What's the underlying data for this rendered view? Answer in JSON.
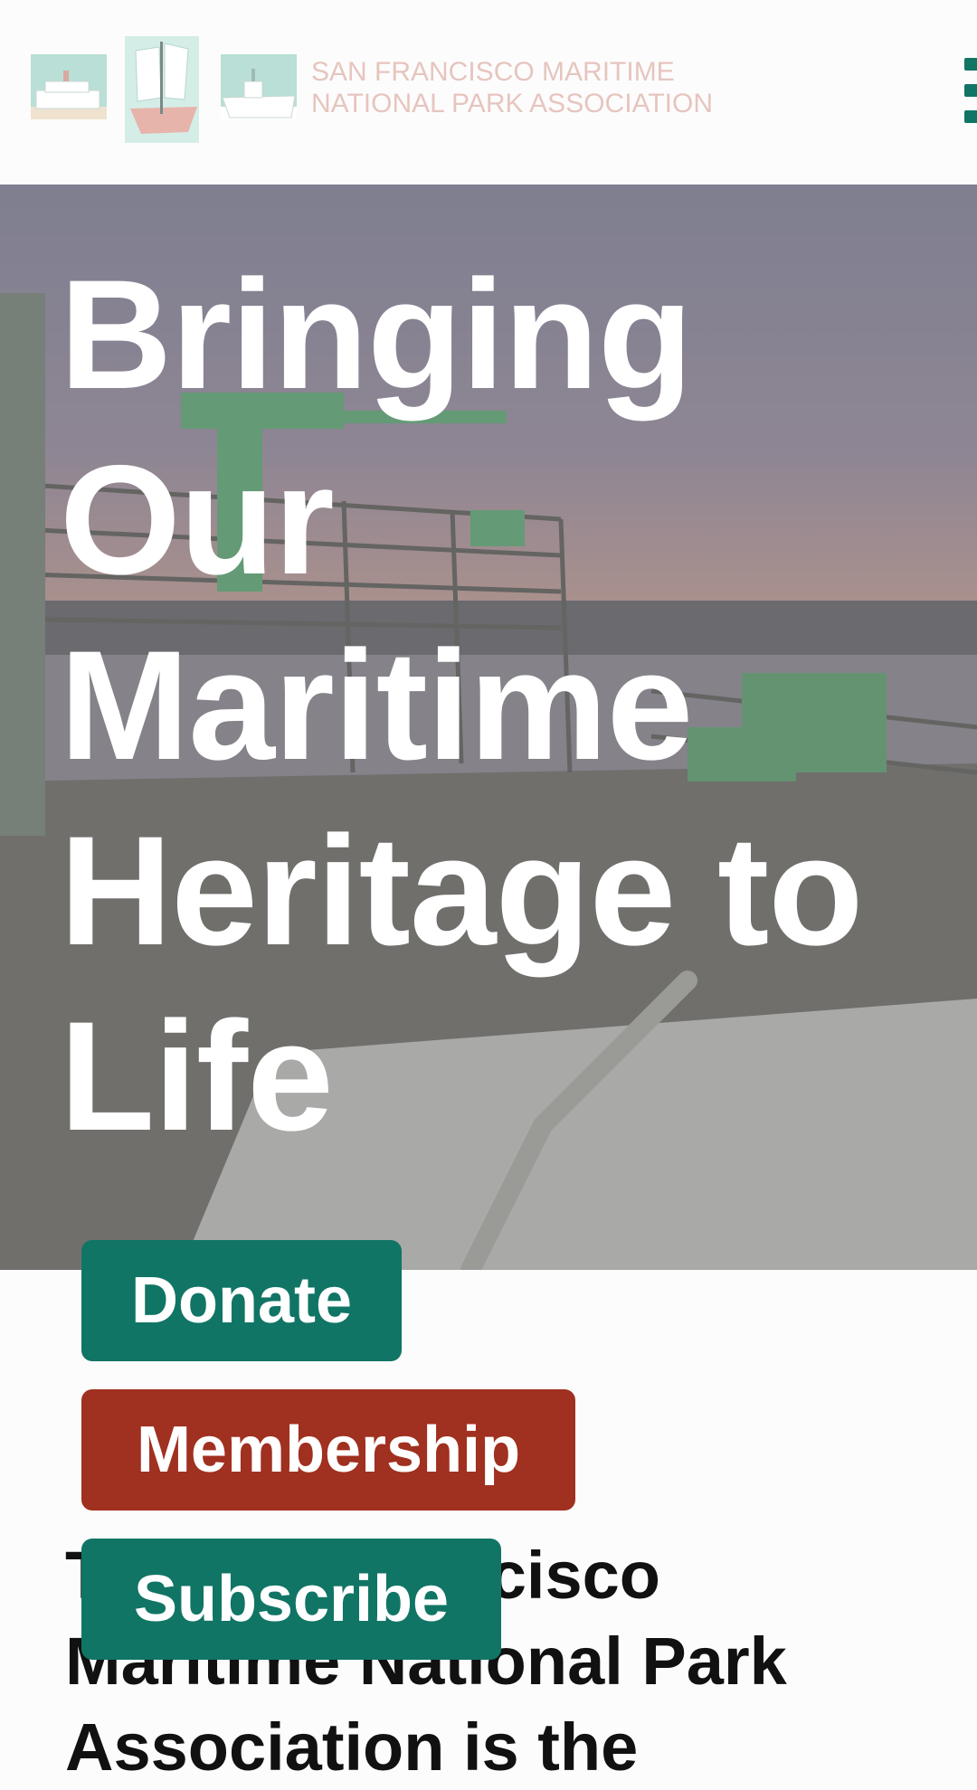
{
  "header": {
    "logo_line1": "San Francisco Maritime",
    "logo_line2": "National Park Association",
    "menu_icon": "hamburger-menu-icon"
  },
  "hero": {
    "title": "Bringing Our Maritime Heritage to Life"
  },
  "cta": {
    "donate_label": "Donate",
    "membership_label": "Membership",
    "subscribe_label": "Subscribe"
  },
  "intro": {
    "text": "The San Francisco Maritime National Park Association is the"
  },
  "colors": {
    "brand_teal": "#117565",
    "brand_red": "#a0301f",
    "logo_text": "#e6c5bf",
    "white": "#ffffff"
  }
}
